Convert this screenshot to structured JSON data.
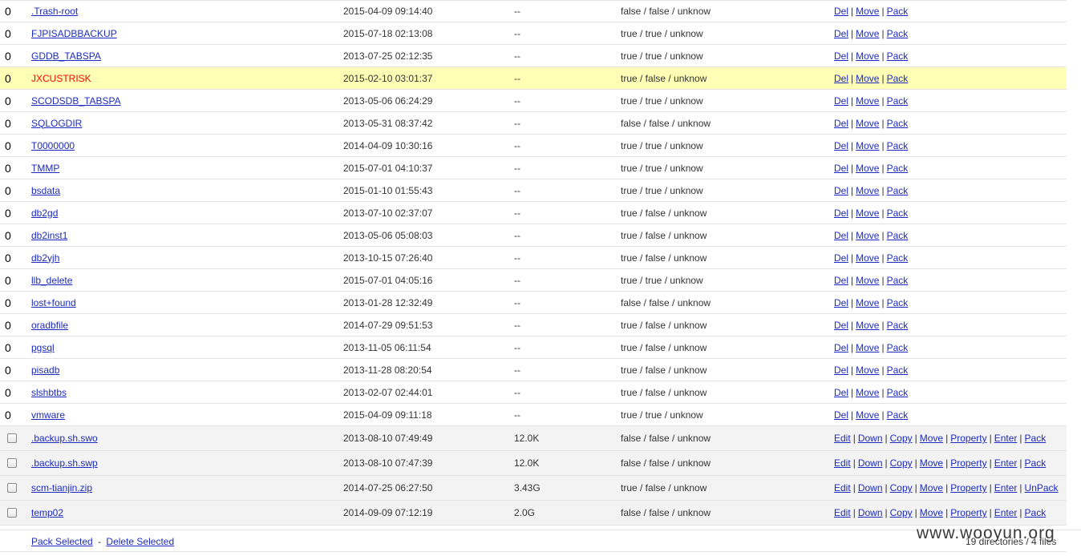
{
  "directories": [
    {
      "sel": "0",
      "name": ".Trash-root",
      "time": "2015-04-09 09:14:40",
      "size": "--",
      "perm": "false / false / unknow"
    },
    {
      "sel": "0",
      "name": "FJPISADBBACKUP",
      "time": "2015-07-18 02:13:08",
      "size": "--",
      "perm": "true / true / unknow"
    },
    {
      "sel": "0",
      "name": "GDDB_TABSPA",
      "time": "2013-07-25 02:12:35",
      "size": "--",
      "perm": "true / true / unknow"
    },
    {
      "sel": "0",
      "name": "JXCUSTRISK",
      "time": "2015-02-10 03:01:37",
      "size": "--",
      "perm": "true / false / unknow",
      "highlighted": true
    },
    {
      "sel": "0",
      "name": "SCODSDB_TABSPA",
      "time": "2013-05-06 06:24:29",
      "size": "--",
      "perm": "true / true / unknow"
    },
    {
      "sel": "0",
      "name": "SQLOGDIR",
      "time": "2013-05-31 08:37:42",
      "size": "--",
      "perm": "false / false / unknow"
    },
    {
      "sel": "0",
      "name": "T0000000",
      "time": "2014-04-09 10:30:16",
      "size": "--",
      "perm": "true / true / unknow"
    },
    {
      "sel": "0",
      "name": "TMMP",
      "time": "2015-07-01 04:10:37",
      "size": "--",
      "perm": "true / true / unknow"
    },
    {
      "sel": "0",
      "name": "bsdata",
      "time": "2015-01-10 01:55:43",
      "size": "--",
      "perm": "true / true / unknow"
    },
    {
      "sel": "0",
      "name": "db2gd",
      "time": "2013-07-10 02:37:07",
      "size": "--",
      "perm": "true / false / unknow"
    },
    {
      "sel": "0",
      "name": "db2inst1",
      "time": "2013-05-06 05:08:03",
      "size": "--",
      "perm": "true / false / unknow"
    },
    {
      "sel": "0",
      "name": "db2yjh",
      "time": "2013-10-15 07:26:40",
      "size": "--",
      "perm": "true / false / unknow"
    },
    {
      "sel": "0",
      "name": "llb_delete",
      "time": "2015-07-01 04:05:16",
      "size": "--",
      "perm": "true / true / unknow"
    },
    {
      "sel": "0",
      "name": "lost+found",
      "time": "2013-01-28 12:32:49",
      "size": "--",
      "perm": "false / false / unknow"
    },
    {
      "sel": "0",
      "name": "oradbfile",
      "time": "2014-07-29 09:51:53",
      "size": "--",
      "perm": "true / false / unknow"
    },
    {
      "sel": "0",
      "name": "pgsql",
      "time": "2013-11-05 06:11:54",
      "size": "--",
      "perm": "true / false / unknow"
    },
    {
      "sel": "0",
      "name": "pisadb",
      "time": "2013-11-28 08:20:54",
      "size": "--",
      "perm": "true / false / unknow"
    },
    {
      "sel": "0",
      "name": "slshbtbs",
      "time": "2013-02-07 02:44:01",
      "size": "--",
      "perm": "true / false / unknow"
    },
    {
      "sel": "0",
      "name": "vmware",
      "time": "2015-04-09 09:11:18",
      "size": "--",
      "perm": "true / true / unknow"
    }
  ],
  "dir_actions": [
    "Del",
    "Move",
    "Pack"
  ],
  "files": [
    {
      "name": ".backup.sh.swo",
      "time": "2013-08-10 07:49:49",
      "size": "12.0K",
      "perm": "false / false / unknow",
      "actions": [
        "Edit",
        "Down",
        "Copy",
        "Move",
        "Property",
        "Enter",
        "Pack"
      ]
    },
    {
      "name": ".backup.sh.swp",
      "time": "2013-08-10 07:47:39",
      "size": "12.0K",
      "perm": "false / false / unknow",
      "actions": [
        "Edit",
        "Down",
        "Copy",
        "Move",
        "Property",
        "Enter",
        "Pack"
      ]
    },
    {
      "name": "scm-tianjin.zip",
      "time": "2014-07-25 06:27:50",
      "size": "3.43G",
      "perm": "true / false / unknow",
      "actions": [
        "Edit",
        "Down",
        "Copy",
        "Move",
        "Property",
        "Enter",
        "UnPack"
      ]
    },
    {
      "name": "temp02",
      "time": "2014-09-09 07:12:19",
      "size": "2.0G",
      "perm": "false / false / unknow",
      "actions": [
        "Edit",
        "Down",
        "Copy",
        "Move",
        "Property",
        "Enter",
        "Pack"
      ]
    }
  ],
  "footer": {
    "pack_selected": "Pack Selected",
    "separator": "-",
    "delete_selected": "Delete Selected",
    "summary": "19 directories / 4 files"
  },
  "watermark": "www.wooyun.org",
  "colors": {
    "link": "#1c2bbd",
    "highlight_row": "#ffffb6",
    "highlight_text": "#ff0000",
    "file_row": "#f3f3f3"
  }
}
